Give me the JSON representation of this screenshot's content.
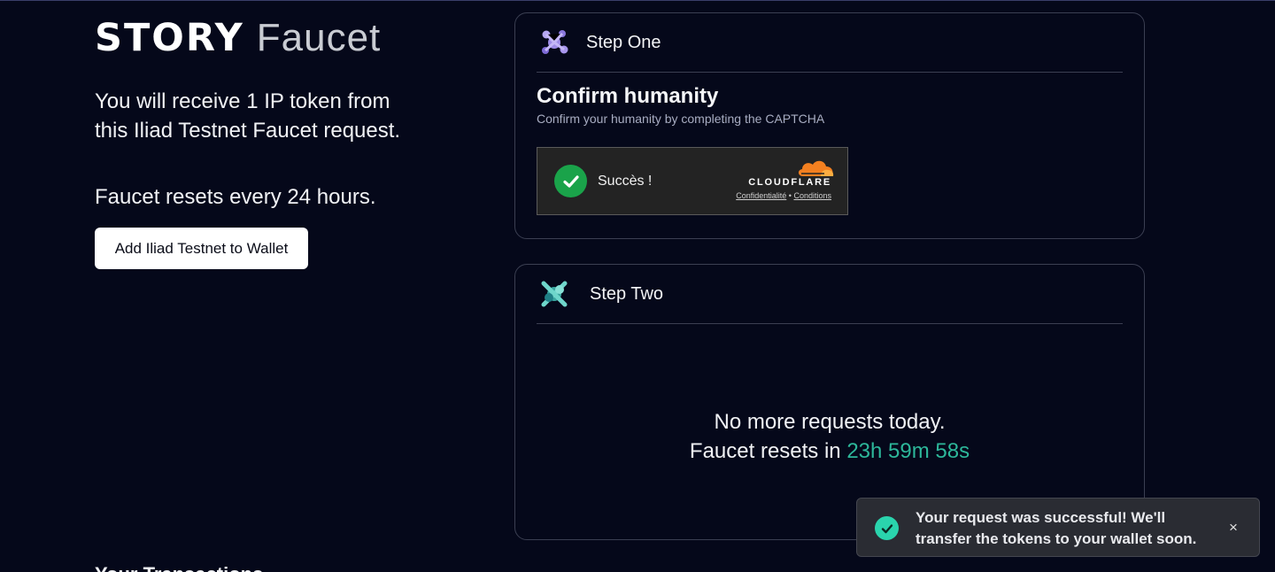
{
  "brand": {
    "name": "STORY",
    "product": "Faucet"
  },
  "intro": {
    "text": "You will receive 1 IP token from this Iliad Testnet Faucet request.",
    "resets": "Faucet resets every 24 hours.",
    "wallet_button": "Add Iliad Testnet to Wallet"
  },
  "transactions": {
    "heading": "Your Transactions"
  },
  "step_one": {
    "title": "Step One",
    "heading": "Confirm humanity",
    "subtitle": "Confirm your humanity by completing the CAPTCHA",
    "captcha": {
      "status": "Succès !",
      "brand": "CLOUDFLARE",
      "privacy_link": "Confidentialité",
      "separator": "•",
      "terms_link": "Conditions"
    }
  },
  "step_two": {
    "title": "Step Two",
    "message": "No more requests today.",
    "reset_prefix": "Faucet resets in",
    "countdown": "23h 59m 58s"
  },
  "toast": {
    "message": "Your request was successful! We'll transfer the tokens to your wallet soon.",
    "close": "×"
  },
  "colors": {
    "background": "#05081a",
    "accent_countdown": "#2db79a",
    "captcha_success": "#1aa34a",
    "toast_success": "#2ad4ad",
    "cloudflare_orange": "#f38020"
  }
}
